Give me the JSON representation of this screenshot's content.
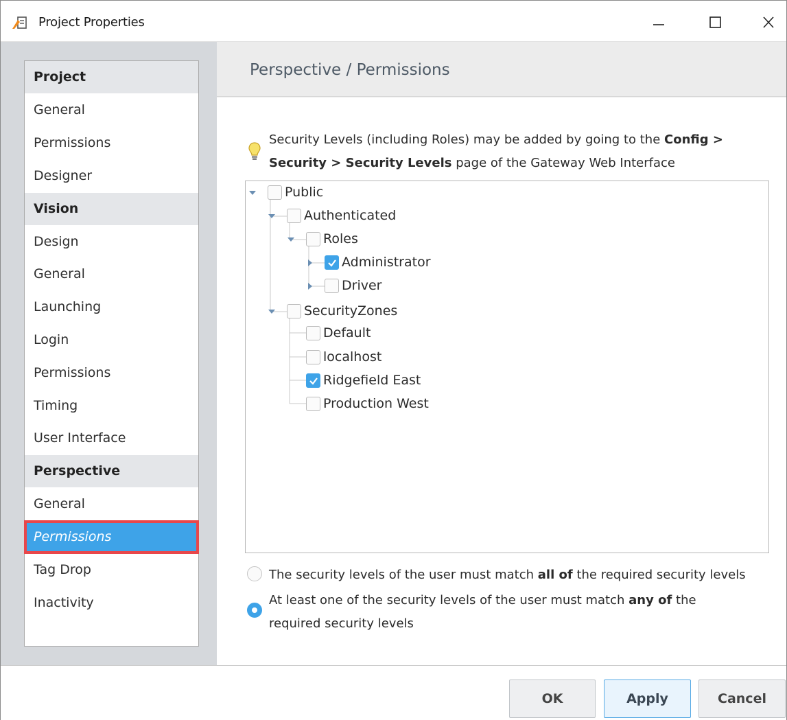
{
  "window": {
    "title": "Project Properties",
    "controls": [
      "minimize-icon",
      "maximize-icon",
      "close-icon"
    ]
  },
  "sidebar": {
    "sections": [
      {
        "label": "Project",
        "items": [
          "General",
          "Permissions",
          "Designer"
        ]
      },
      {
        "label": "Vision",
        "items": [
          "Design",
          "General",
          "Launching",
          "Login",
          "Permissions",
          "Timing",
          "User Interface"
        ]
      },
      {
        "label": "Perspective",
        "items": [
          "General",
          "Permissions",
          "Tag Drop",
          "Inactivity"
        ]
      }
    ],
    "selected": "Perspective / Permissions"
  },
  "main": {
    "title": "Perspective / Permissions",
    "info": {
      "icon": "lightbulb-icon",
      "line1_pre": "Security Levels (including Roles) may be added by going to the ",
      "line1_bold": "Config >",
      "line2_bold": "Security > Security Levels",
      "line2_post": " page of the Gateway Web Interface"
    },
    "tree": [
      {
        "label": "Public",
        "checked": false,
        "expanded": true
      },
      {
        "label": "Authenticated",
        "checked": false,
        "expanded": true
      },
      {
        "label": "Roles",
        "checked": false,
        "expanded": true
      },
      {
        "label": "Administrator",
        "checked": true,
        "expanded": false
      },
      {
        "label": "Driver",
        "checked": false,
        "expanded": false
      },
      {
        "label": "SecurityZones",
        "checked": false,
        "expanded": true
      },
      {
        "label": "Default",
        "checked": false
      },
      {
        "label": "localhost",
        "checked": false
      },
      {
        "label": "Ridgefield East",
        "checked": true
      },
      {
        "label": "Production West",
        "checked": false
      }
    ],
    "match_options": {
      "all": {
        "pre": "The security levels of the user must match ",
        "bold": "all of",
        "post": " the required security levels",
        "selected": false
      },
      "any": {
        "pre": "At least one of the security levels of the user must match ",
        "bold": "any of",
        "post": " the",
        "line2": "required security levels",
        "selected": true
      }
    }
  },
  "footer": {
    "ok_label": "OK",
    "apply_label": "Apply",
    "cancel_label": "Cancel"
  },
  "colors": {
    "accent": "#3ea3e8",
    "highlight_border": "#e8474b"
  }
}
